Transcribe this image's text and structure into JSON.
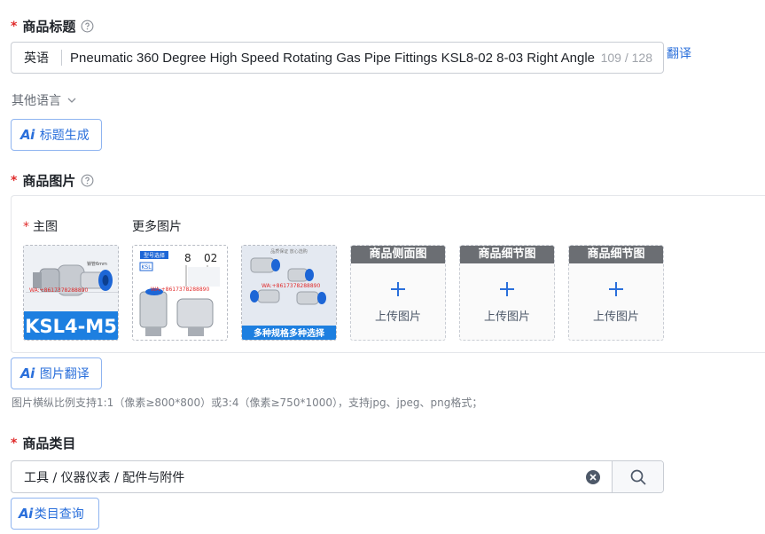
{
  "title_section": {
    "label": "商品标题",
    "lang_prefix": "英语",
    "value": "Pneumatic 360 Degree High Speed Rotating Gas Pipe Fittings KSL8-02 8-03 Right Angle",
    "counter": "109 / 128",
    "translate_label": "翻译",
    "other_lang_label": "其他语言",
    "ai_button_label": "标题生成"
  },
  "image_section": {
    "label": "商品图片",
    "main_label": "主图",
    "more_label": "更多图片",
    "main_image": {
      "caption": "KSL4-M5",
      "watermark": "WA:+8617378288890",
      "tag": "锁管6mm"
    },
    "more_images": [
      {
        "tags": [
          "型号选择"
        ],
        "code": [
          "KSL",
          "8",
          "02"
        ],
        "watermark": "WA:+8617378288890"
      },
      {
        "banner": "多种规格多种选择",
        "top_text": "品质保证 放心选购",
        "watermark": "WA:+8617378288890"
      }
    ],
    "upload_slots": [
      {
        "title": "商品侧面图",
        "text": "上传图片"
      },
      {
        "title": "商品细节图",
        "text": "上传图片"
      },
      {
        "title": "商品细节图",
        "text": "上传图片"
      }
    ],
    "ai_button_label": "图片翻译",
    "hint": "图片横纵比例支持1:1（像素≥800*800）或3:4（像素≥750*1000），支持jpg、jpeg、png格式；"
  },
  "category_section": {
    "label": "商品类目",
    "value": "工具 / 仪器仪表 / 配件与附件",
    "ai_button_label": "类目查询"
  },
  "ai_mark": "Ai",
  "colors": {
    "accent": "#2a6fdb",
    "required": "#e02b2b",
    "border": "#c9cdd4",
    "muted": "#646a73"
  }
}
